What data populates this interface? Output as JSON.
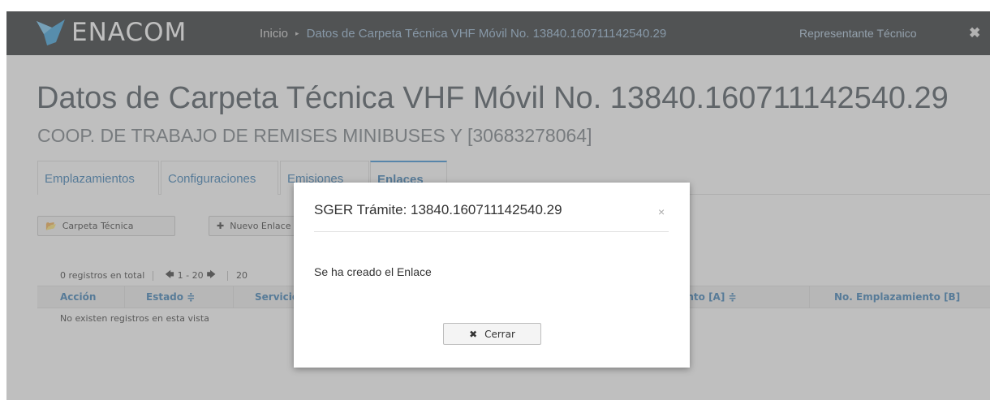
{
  "header": {
    "brand": "ENACOM",
    "breadcrumb_home": "Inicio",
    "breadcrumb_separator": "▸",
    "breadcrumb_current": "Datos de Carpeta Técnica VHF Móvil No. 13840.160711142540.29",
    "user_link": "Representante Técnico",
    "close_glyph": "✖",
    "colors": {
      "bar": "#222628",
      "logo_accent": "#2e9ad8"
    }
  },
  "page": {
    "title": "Datos de Carpeta Técnica VHF Móvil No. 13840.160711142540.29",
    "subtitle": "COOP. DE TRABAJO DE REMISES MINIBUSES Y [30683278064]"
  },
  "tabs": [
    {
      "label": "Emplazamientos",
      "active": false
    },
    {
      "label": "Configuraciones",
      "active": false
    },
    {
      "label": "Emisiones",
      "active": false
    },
    {
      "label": "Enlaces",
      "active": true
    }
  ],
  "toolbar": {
    "carpeta_label": "Carpeta Técnica",
    "carpeta_icon": "folder-icon",
    "nuevo_label": "Nuevo Enlace",
    "nuevo_icon": "plus-icon"
  },
  "pager": {
    "total": "0 registros en total",
    "range": "1 - 20",
    "page_size": "20"
  },
  "grid": {
    "columns": [
      "Acción",
      "Estado ≑",
      "Servicio ≑",
      "No. Emplazamiento [A] ≑",
      "No. Emplazamiento [B]"
    ],
    "empty_message": "No existen registros en esta vista"
  },
  "modal": {
    "title": "SGER Trámite: 13840.160711142540.29",
    "close_glyph": "×",
    "message": "Se ha creado el Enlace",
    "button_label": "Cerrar",
    "button_icon": "close-icon"
  }
}
